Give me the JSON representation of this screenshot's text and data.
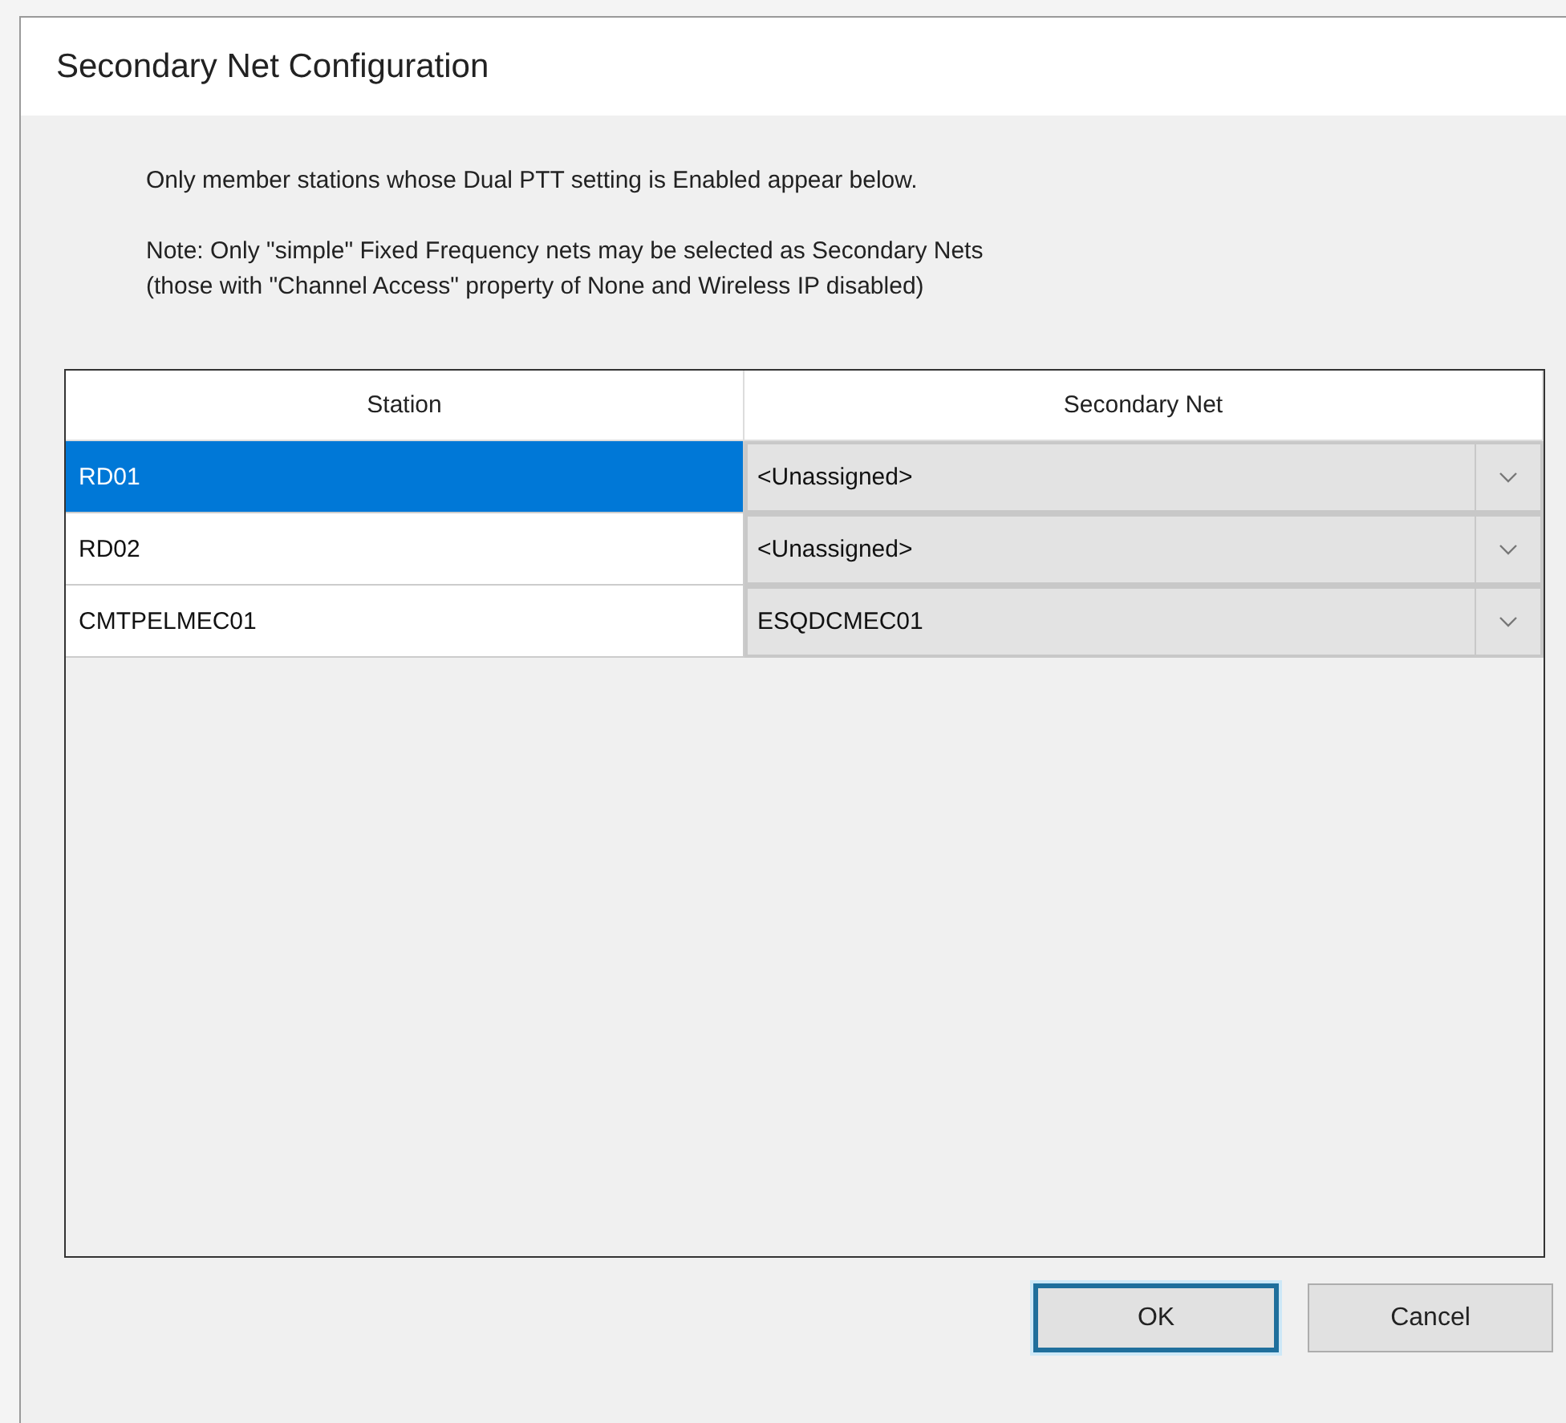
{
  "dialog": {
    "title": "Secondary Net Configuration"
  },
  "notes": [
    "Only member stations whose Dual PTT setting is Enabled appear below.",
    "Note: Only \"simple\" Fixed Frequency nets may be selected as Secondary Nets\n(those with \"Channel Access\" property of None and Wireless IP disabled)"
  ],
  "table": {
    "columns": [
      "Station",
      "Secondary Net"
    ],
    "rows": [
      {
        "station": "RD01",
        "secondary_net": "<Unassigned>",
        "selected": true
      },
      {
        "station": "RD02",
        "secondary_net": "<Unassigned>",
        "selected": false
      },
      {
        "station": "CMTPELMEC01",
        "secondary_net": "ESQDCMEC01",
        "selected": false
      }
    ]
  },
  "buttons": [
    {
      "label": "OK",
      "default": true
    },
    {
      "label": "Cancel",
      "default": false
    }
  ]
}
